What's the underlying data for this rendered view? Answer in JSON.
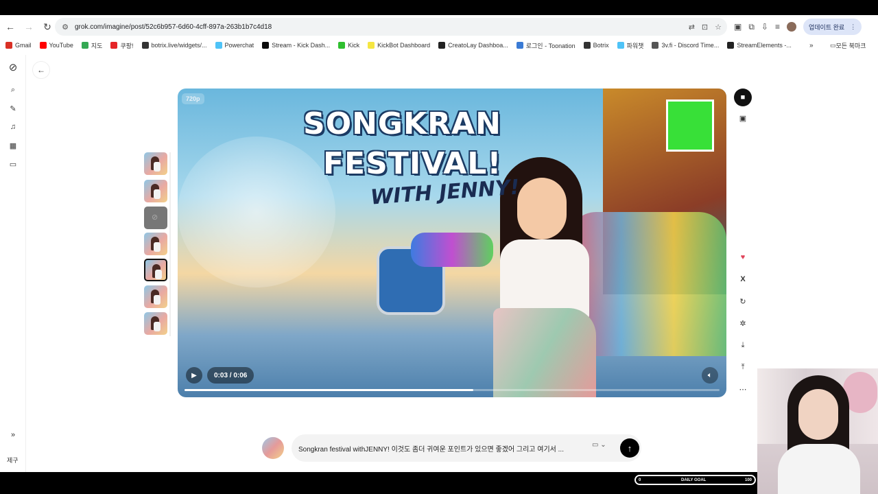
{
  "browser": {
    "url": "grok.com/imagine/post/52c6b957-6d60-4cff-897a-263b1b7c4d18",
    "update_button": "업데이트 완료"
  },
  "bookmarks": [
    {
      "label": "Gmail",
      "color": "#d93025"
    },
    {
      "label": "YouTube",
      "color": "#ff0000"
    },
    {
      "label": "지도",
      "color": "#34a853"
    },
    {
      "label": "쿠팡!",
      "color": "#e52528"
    },
    {
      "label": "botrix.live/widgets/...",
      "color": "#333333"
    },
    {
      "label": "Powerchat",
      "color": "#4fc3f7"
    },
    {
      "label": "Stream - Kick Dash...",
      "color": "#0a0a0a"
    },
    {
      "label": "Kick",
      "color": "#2fbf2f"
    },
    {
      "label": "KickBot Dashboard",
      "color": "#f5e642"
    },
    {
      "label": "CreatoLay Dashboa...",
      "color": "#222222"
    },
    {
      "label": "로그인 - Toonation",
      "color": "#3a7bd5"
    },
    {
      "label": "Botrix",
      "color": "#333333"
    },
    {
      "label": "파워챗",
      "color": "#4fc3f7"
    },
    {
      "label": "3v.fi - Discord Time...",
      "color": "#555555"
    },
    {
      "label": "StreamElements -...",
      "color": "#222222"
    }
  ],
  "bookmarks_all": "모든 북마크",
  "sidebar": {
    "bottom_label": "제구"
  },
  "player": {
    "quality_badge": "720p",
    "title_line1": "SONGKRAN",
    "title_line2": "FESTIVAL!",
    "title_line3": "WITH JENNY!",
    "time": "0:03 / 0:06",
    "progress": 0.54
  },
  "prompt": {
    "text": "Songkran festival withJENNY! 이것도 좀더 귀여운 포인트가 있으면 좋겠어 그리고 여기서 ..."
  },
  "overlay": {
    "goal_label": "DAILY GOAL",
    "goal_min": "0",
    "goal_max": "100"
  },
  "colors": {
    "accent": "#000000",
    "like": "#e0445a",
    "kick_green": "#38e038"
  },
  "icons": {
    "like": "heart-icon",
    "share_x": "x-logo-icon",
    "remix": "refresh-icon",
    "download": "download-icon",
    "upload": "share-icon",
    "more": "more-dots-icon"
  }
}
